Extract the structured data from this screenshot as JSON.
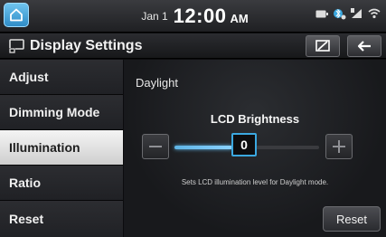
{
  "status_bar": {
    "date": "Jan 1",
    "time": "12:00",
    "ampm": "AM",
    "icons": [
      "battery-icon",
      "bluetooth-icon",
      "signal-icon",
      "wifi-icon"
    ]
  },
  "header": {
    "title": "Display Settings"
  },
  "sidebar": {
    "items": [
      {
        "label": "Adjust"
      },
      {
        "label": "Dimming Mode"
      },
      {
        "label": "Illumination"
      },
      {
        "label": "Ratio"
      },
      {
        "label": "Reset"
      }
    ],
    "selected": "Illumination"
  },
  "main": {
    "section_title": "Daylight",
    "slider_label": "LCD Brightness",
    "value": "0",
    "fill_fraction": 0.4,
    "hint": "Sets LCD illumination level for Daylight mode.",
    "reset_label": "Reset"
  },
  "colors": {
    "accent": "#3ba8e0",
    "home_button": "#4aaae0"
  }
}
